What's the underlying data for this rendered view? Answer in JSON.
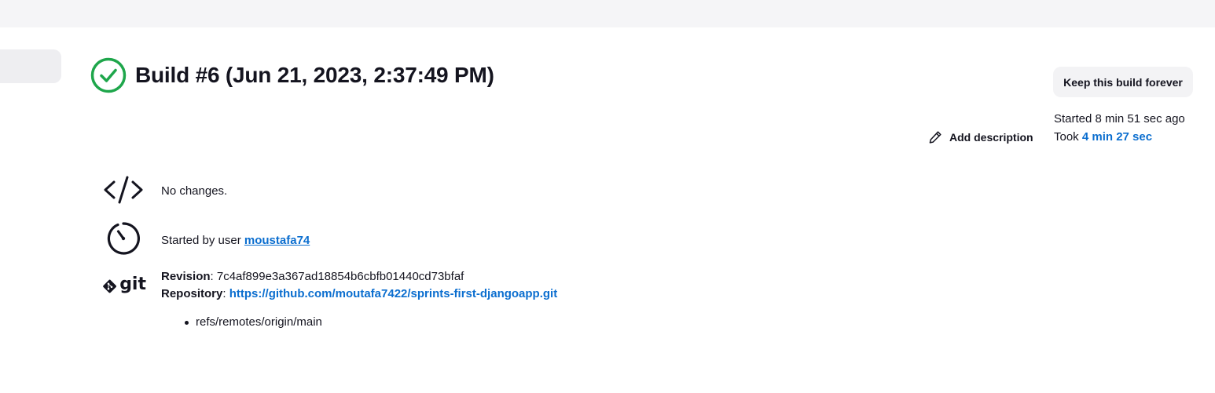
{
  "build": {
    "title": "Build #6 (Jun 21, 2023, 2:37:49 PM)",
    "status": "success",
    "status_color": "#1ea64b"
  },
  "actions": {
    "keep_forever_label": "Keep this build forever",
    "add_description_label": "Add description"
  },
  "timing": {
    "started_ago": "Started 8 min 51 sec ago",
    "took_prefix": "Took ",
    "took_duration": "4 min 27 sec"
  },
  "summary": {
    "changes_text": "No changes.",
    "started_by_prefix": "Started by user ",
    "started_by_user": "moustafa74",
    "git_logo_text": "git",
    "revision_label": "Revision",
    "revision_value": ": 7c4af899e3a367ad18854b6cbfb01440cd73bfaf",
    "repository_label": "Repository",
    "repository_sep": ": ",
    "repository_url": "https://github.com/moutafa7422/sprints-first-djangoapp.git",
    "branches": [
      "refs/remotes/origin/main"
    ]
  },
  "colors": {
    "link": "#0b6ecf",
    "text": "#14141f",
    "topbar": "#f5f5f7"
  }
}
